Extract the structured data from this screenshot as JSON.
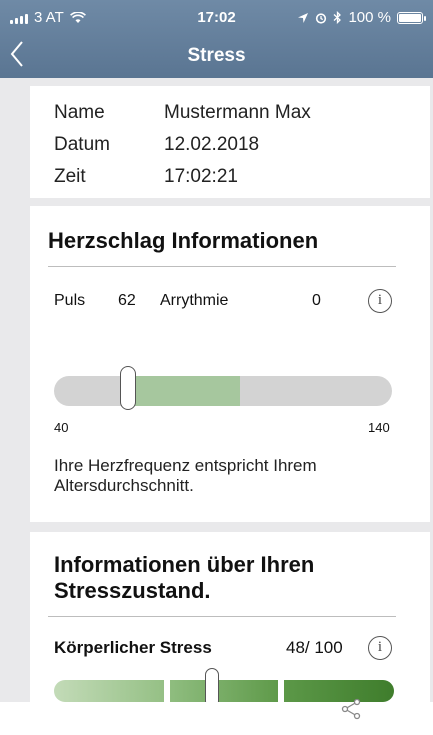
{
  "status_bar": {
    "carrier": "3 AT",
    "time": "17:02",
    "battery": "100 %"
  },
  "nav": {
    "title": "Stress"
  },
  "info": {
    "name_label": "Name",
    "name_value": "Mustermann Max",
    "date_label": "Datum",
    "date_value": "12.02.2018",
    "time_label": "Zeit",
    "time_value": "17:02:21"
  },
  "heart": {
    "title": "Herzschlag Informationen",
    "pulse_label": "Puls",
    "pulse_value": "62",
    "arrhythmia_label": "Arrythmie",
    "arrhythmia_value": "0",
    "range_min": "40",
    "range_max": "140",
    "description": "Ihre Herzfrequenz entspricht Ihrem Altersdurchschnitt."
  },
  "stress": {
    "title": "Informationen über Ihren Stresszustand.",
    "physical_label": "Körperlicher Stress",
    "physical_value": "48/ 100"
  },
  "colors": {
    "header": "#5f7b98",
    "card": "#ffffff",
    "background": "#e9e9eb",
    "range_track": "#d3d3d3",
    "range_zone": "#a6c79e",
    "stress_light": "#a8cb9c",
    "stress_mid": "#7fb06a",
    "stress_dark": "#4f8a3a"
  },
  "icons": {
    "back": "chevron-left-icon",
    "info": "info-icon",
    "share": "share-icon"
  }
}
